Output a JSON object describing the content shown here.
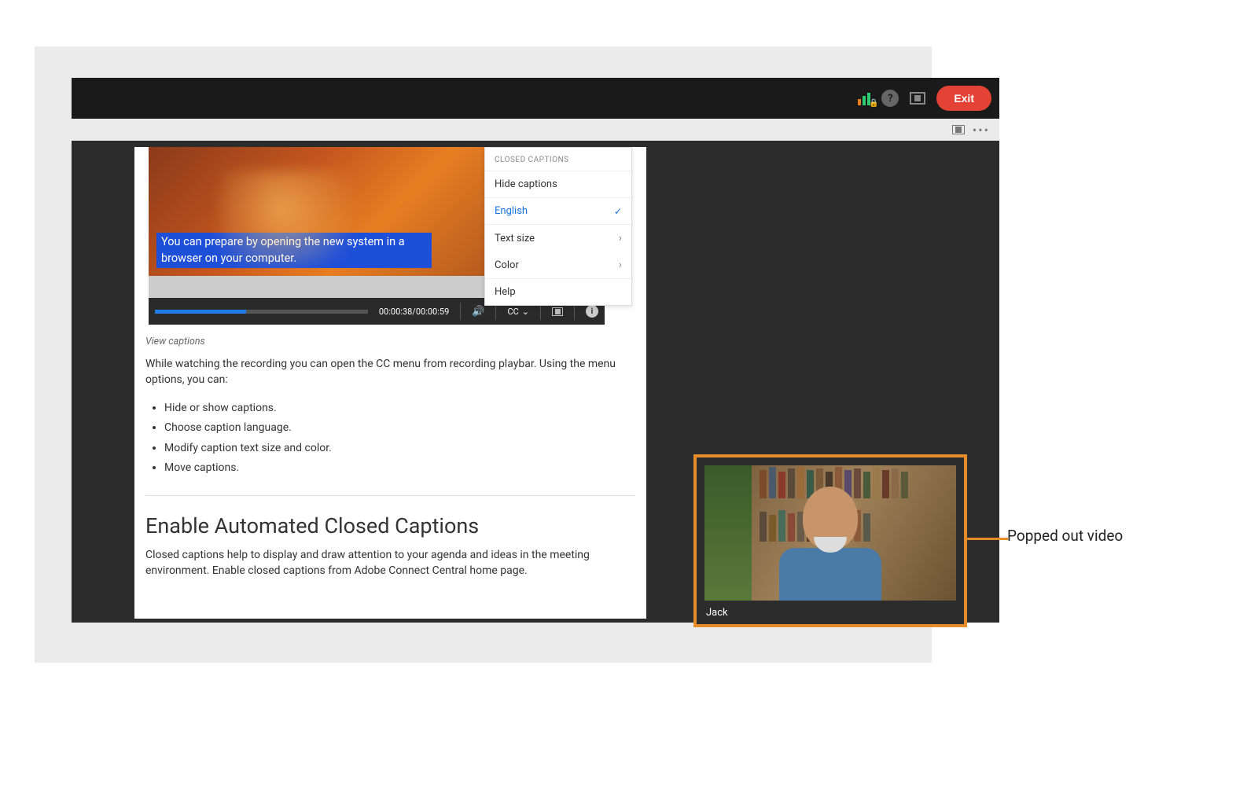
{
  "header": {
    "exit_label": "Exit"
  },
  "video": {
    "caption_text": "You can prepare by opening the new system in a browser on your computer.",
    "time_display": "00:00:38/00:00:59",
    "cc_label": "CC"
  },
  "cc_menu": {
    "title": "CLOSED CAPTIONS",
    "hide": "Hide captions",
    "selected_lang": "English",
    "text_size": "Text size",
    "color": "Color",
    "help": "Help"
  },
  "document": {
    "figure_caption": "View captions",
    "paragraph_1": "While watching the recording you can open the CC menu from recording playbar. Using the menu options, you can:",
    "bullets": {
      "b1": "Hide or show captions.",
      "b2": "Choose caption language.",
      "b3": "Modify caption text size and color.",
      "b4": "Move captions."
    },
    "heading_2": "Enable Automated Closed Captions",
    "paragraph_2": "Closed captions help to display and draw attention to your agenda and ideas in the meeting environment. Enable closed captions from Adobe Connect Central home page."
  },
  "popped_video": {
    "user_name": "Jack"
  },
  "annotation": {
    "label": "Popped out video"
  }
}
